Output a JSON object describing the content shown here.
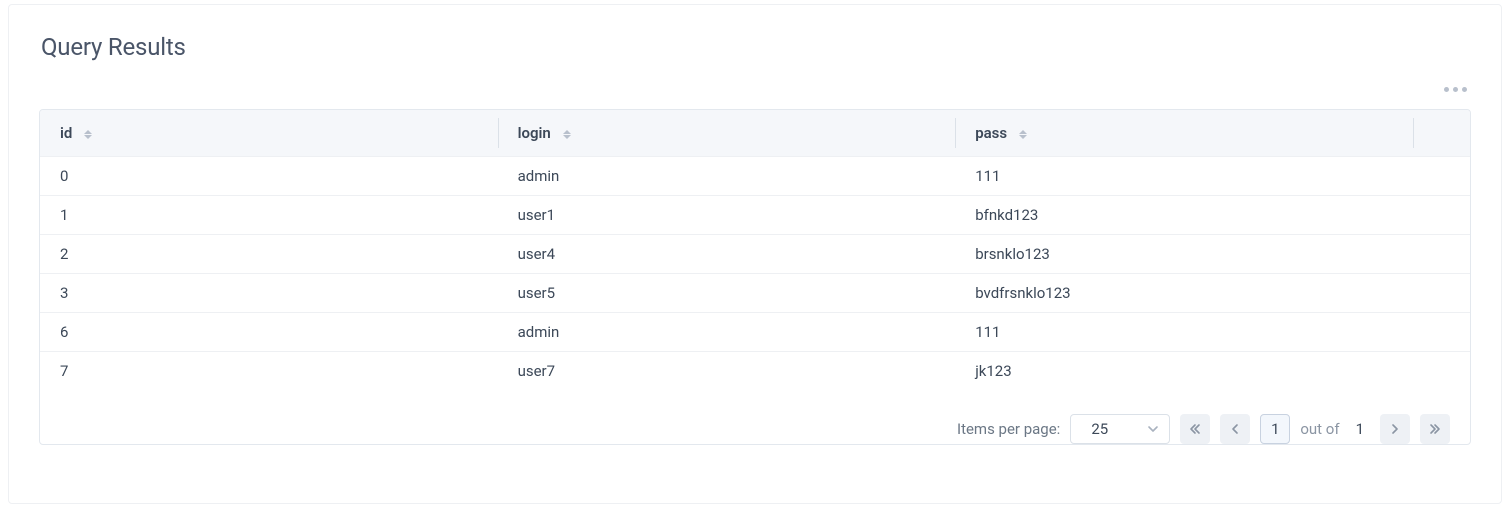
{
  "title": "Query Results",
  "table": {
    "columns": [
      "id",
      "login",
      "pass"
    ],
    "rows": [
      {
        "id": "0",
        "login": "admin",
        "pass": "111"
      },
      {
        "id": "1",
        "login": "user1",
        "pass": "bfnkd123"
      },
      {
        "id": "2",
        "login": "user4",
        "pass": "brsnklo123"
      },
      {
        "id": "3",
        "login": "user5",
        "pass": "bvdfrsnklo123"
      },
      {
        "id": "6",
        "login": "admin",
        "pass": "111"
      },
      {
        "id": "7",
        "login": "user7",
        "pass": "jk123"
      }
    ]
  },
  "pagination": {
    "items_per_page_label": "Items per page:",
    "items_per_page_value": "25",
    "current_page": "1",
    "out_of_label": "out of",
    "total_pages": "1"
  }
}
